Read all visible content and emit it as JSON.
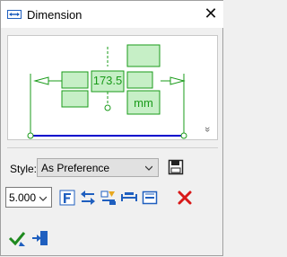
{
  "window": {
    "title": "Dimension",
    "close_glyph": "✕"
  },
  "preview": {
    "value_text": "173.5",
    "units_text": "mm",
    "expand_glyph": "»"
  },
  "style": {
    "label": "Style:",
    "selected": "As Preference"
  },
  "precision": {
    "selected": "5.000"
  },
  "icons": {
    "title": "dimension-icon",
    "save": "save-floppy-icon",
    "font": "font-icon",
    "arrows": "arrow-direction-icon",
    "symbols": "symbol-insert-icon",
    "dim_line": "dimension-line-icon",
    "extension": "extension-line-icon",
    "delete": "delete-icon",
    "ok": "ok-check-icon",
    "exit": "exit-icon"
  },
  "colors": {
    "accent_green": "#1a9b1a",
    "line_blue": "#0000cc",
    "icon_blue": "#1f5fbf",
    "delete_red": "#d81818"
  }
}
